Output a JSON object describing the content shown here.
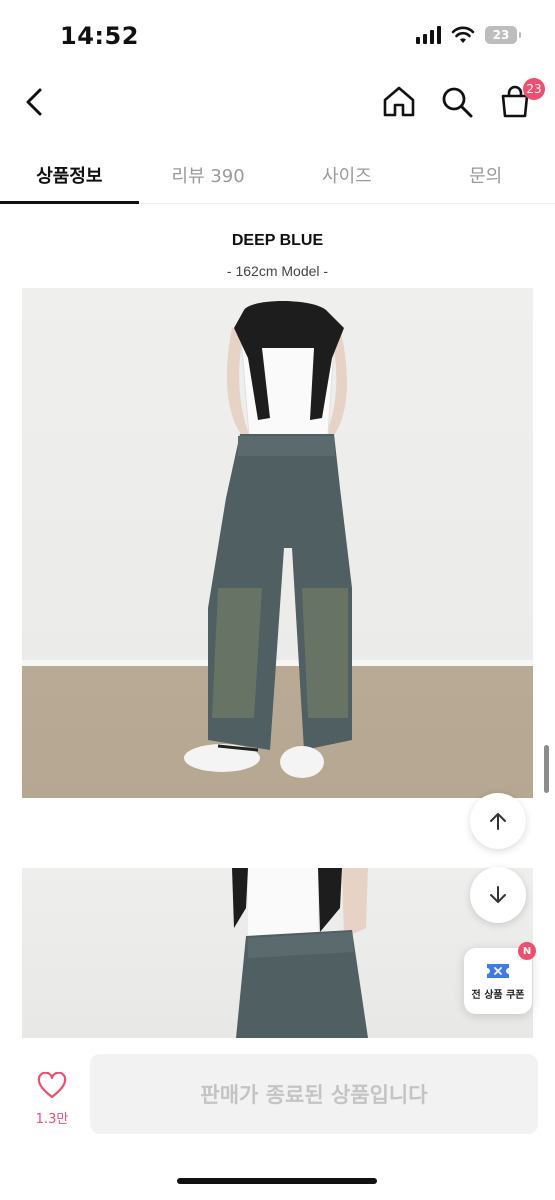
{
  "status_bar": {
    "time": "14:52",
    "battery": "23"
  },
  "nav": {
    "cart_badge": "23"
  },
  "tabs": [
    {
      "label": "상품정보",
      "active": true
    },
    {
      "label": "리뷰 390",
      "active": false
    },
    {
      "label": "사이즈",
      "active": false
    },
    {
      "label": "문의",
      "active": false
    }
  ],
  "product": {
    "title": "DEEP BLUE",
    "subtitle": "- 162cm Model -"
  },
  "coupon": {
    "label": "전 상품 쿠폰",
    "badge": "N"
  },
  "bottom": {
    "like_count": "1.3만",
    "buy_label": "판매가 종료된 상품입니다"
  },
  "colors": {
    "accent": "#f04e6e",
    "disabled_bg": "#f2f2f2",
    "disabled_text": "#c4c4c4"
  }
}
